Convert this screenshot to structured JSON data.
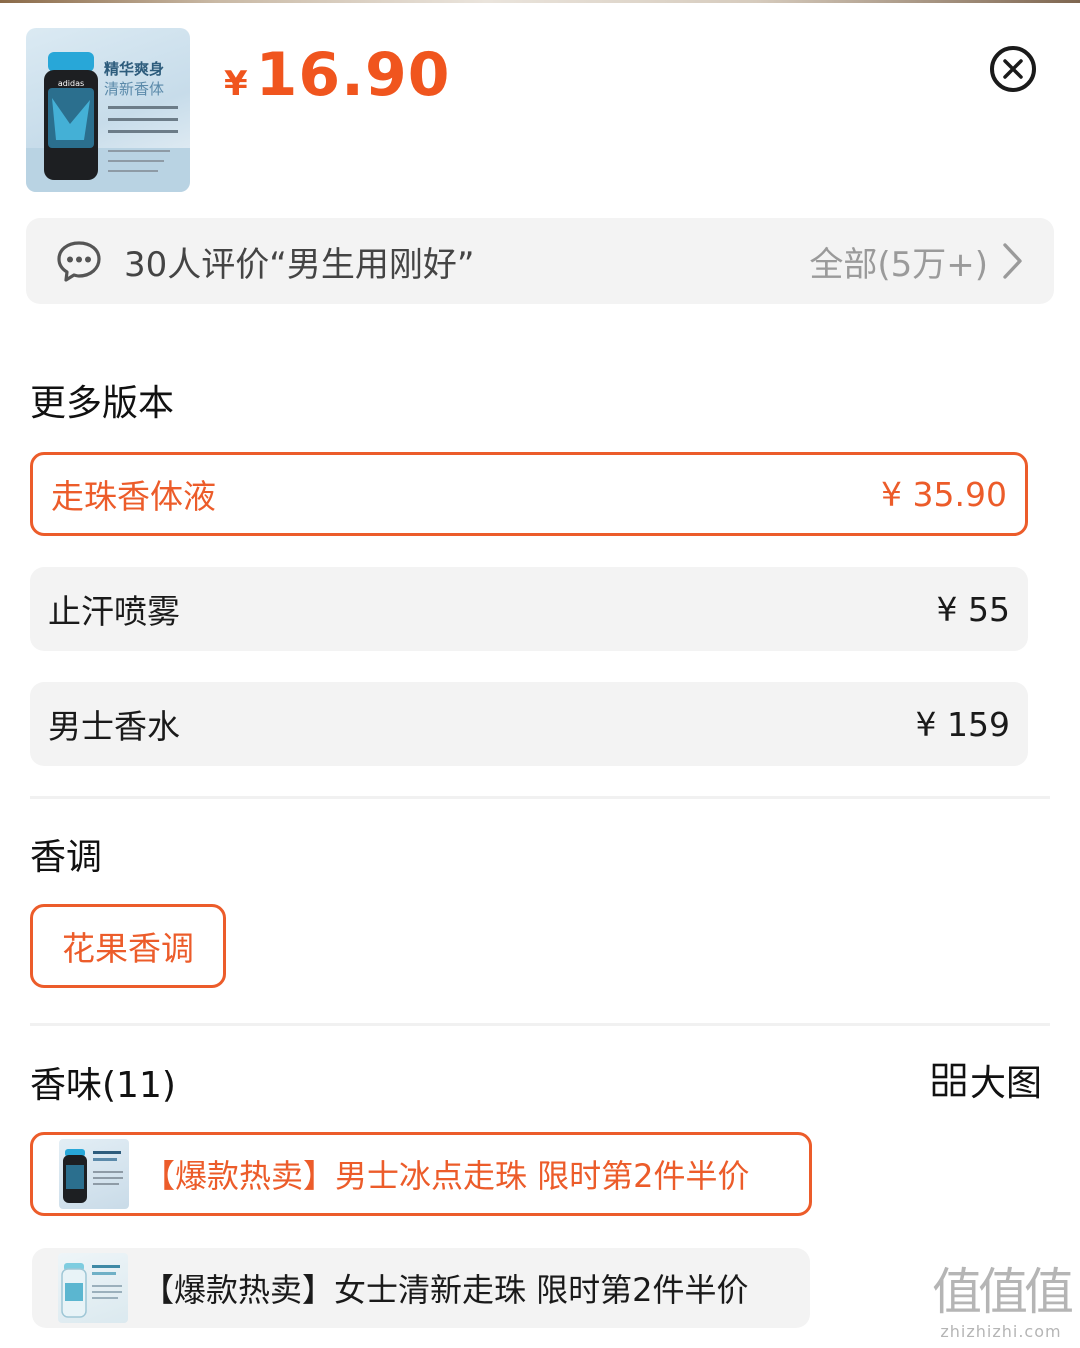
{
  "product": {
    "thumb_caption_1": "精华爽身",
    "thumb_caption_2": "清新香体",
    "price_symbol": "¥",
    "price": "16.90"
  },
  "review": {
    "icon": "chat-bubble-icon",
    "text": "30人评价“男生用刚好”",
    "all_label": "全部(5万+)"
  },
  "versions": {
    "title": "更多版本",
    "items": [
      {
        "label": "走珠香体液",
        "price": "¥ 35.90",
        "selected": true
      },
      {
        "label": "止汗喷雾",
        "price": "¥ 55",
        "selected": false
      },
      {
        "label": "男士香水",
        "price": "¥ 159",
        "selected": false
      }
    ]
  },
  "notes": {
    "title": "香调",
    "options": [
      {
        "label": "花果香调",
        "selected": true
      }
    ]
  },
  "scents": {
    "title": "香味(11)",
    "big_view_label": "大图",
    "items": [
      {
        "label": "【爆款热卖】男士冰点走珠 限时第2件半价",
        "selected": true
      },
      {
        "label": "【爆款热卖】女士清新走珠 限时第2件半价",
        "selected": false
      }
    ]
  },
  "watermark": {
    "logo": "值值值",
    "url": "zhizhizhi.com"
  },
  "colors": {
    "accent": "#ec5c2a",
    "price": "#f0551e",
    "row_bg": "#f3f3f3"
  }
}
